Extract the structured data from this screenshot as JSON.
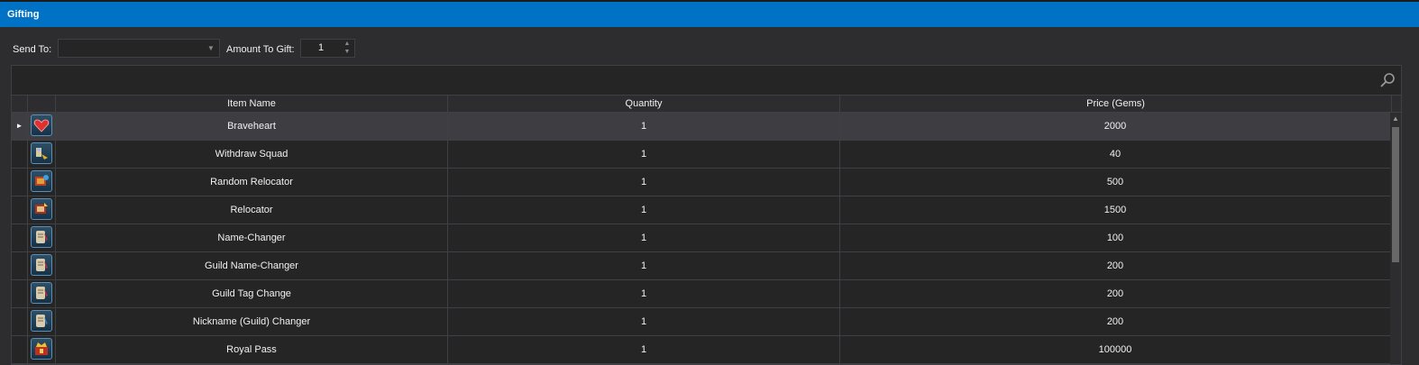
{
  "window": {
    "title": "Gifting"
  },
  "toolbar": {
    "send_to_label": "Send To:",
    "send_to_value": "",
    "amount_label": "Amount To Gift:",
    "amount_value": "1"
  },
  "grid": {
    "columns": [
      "Item Name",
      "Quantity",
      "Price (Gems)"
    ],
    "rows": [
      {
        "name": "Braveheart",
        "quantity": "1",
        "price": "2000",
        "icon": "heart-icon",
        "selected": true
      },
      {
        "name": "Withdraw Squad",
        "quantity": "1",
        "price": "40",
        "icon": "withdraw-squad-icon"
      },
      {
        "name": "Random Relocator",
        "quantity": "1",
        "price": "500",
        "icon": "random-relocator-icon"
      },
      {
        "name": "Relocator",
        "quantity": "1",
        "price": "1500",
        "icon": "relocator-icon"
      },
      {
        "name": "Name-Changer",
        "quantity": "1",
        "price": "100",
        "icon": "scroll-icon"
      },
      {
        "name": "Guild Name-Changer",
        "quantity": "1",
        "price": "200",
        "icon": "scroll-icon"
      },
      {
        "name": "Guild Tag Change",
        "quantity": "1",
        "price": "200",
        "icon": "scroll-icon"
      },
      {
        "name": "Nickname (Guild) Changer",
        "quantity": "1",
        "price": "200",
        "icon": "scroll-icon"
      },
      {
        "name": "Royal Pass",
        "quantity": "1",
        "price": "100000",
        "icon": "royal-pass-icon"
      }
    ]
  },
  "colors": {
    "title_bar": "#0072c6",
    "background": "#2d2d30",
    "grid_background": "#252526",
    "selected_row": "#3e3e42",
    "border": "#3f3f46"
  }
}
